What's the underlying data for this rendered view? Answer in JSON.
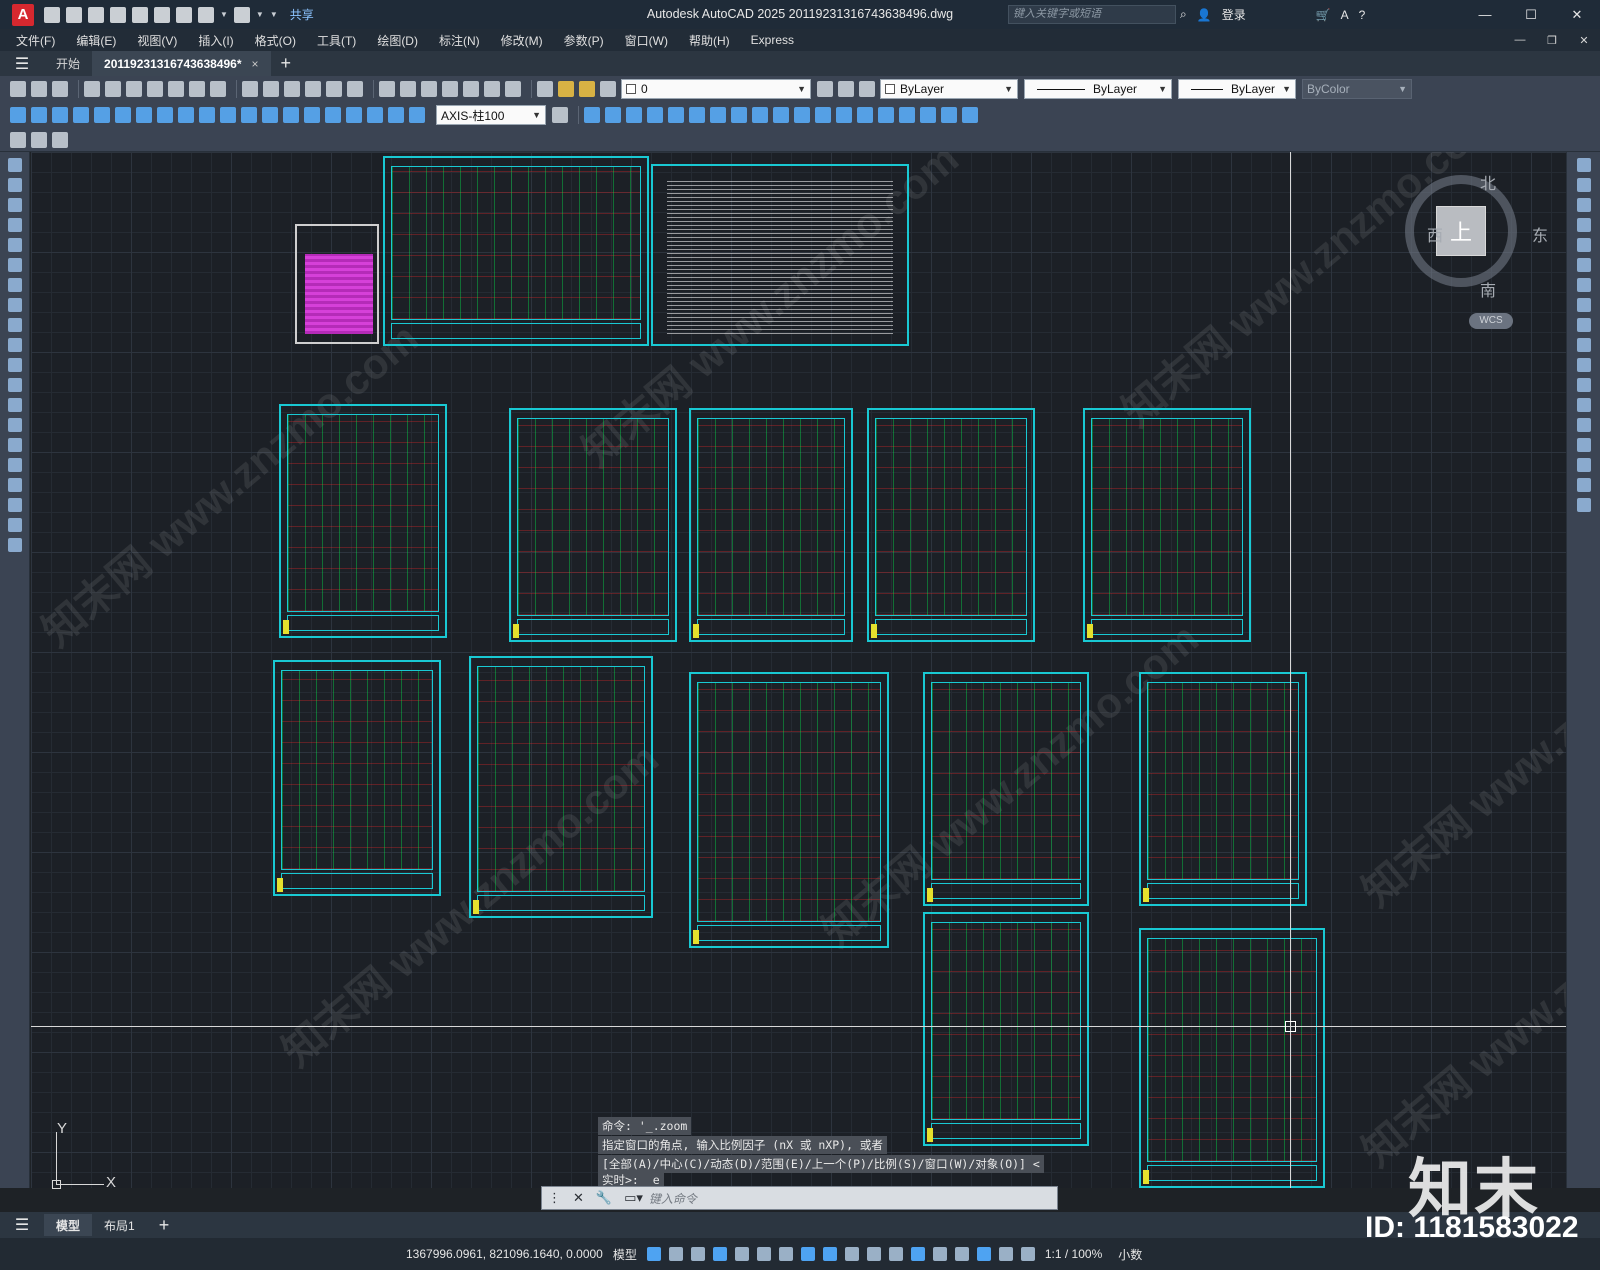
{
  "window": {
    "app_letter": "A",
    "title": "Autodesk AutoCAD 2025    20119231316743638496.dwg",
    "share_label": "共享",
    "search_placeholder": "键入关键字或短语",
    "login_label": "登录",
    "help_label": "?"
  },
  "menu": [
    "文件(F)",
    "编辑(E)",
    "视图(V)",
    "插入(I)",
    "格式(O)",
    "工具(T)",
    "绘图(D)",
    "标注(N)",
    "修改(M)",
    "参数(P)",
    "窗口(W)",
    "帮助(H)",
    "Express"
  ],
  "tabs": {
    "start_label": "开始",
    "active_doc": "20119231316743638496*",
    "close": "×",
    "add": "+"
  },
  "toolbar": {
    "layer_value": "0",
    "color_value": "ByLayer",
    "linetype_value": "ByLayer",
    "lineweight_value": "ByLayer",
    "plotstyle_value": "ByColor",
    "dimstyle_value": "AXIS-柱100"
  },
  "viewcube": {
    "north": "北",
    "south": "南",
    "east": "东",
    "west": "西",
    "top": "上",
    "wcs": "WCS"
  },
  "ucs": {
    "y": "Y",
    "x": "X"
  },
  "command": {
    "line1": "命令: '_.zoom",
    "line2": "指定窗口的角点, 输入比例因子 (nX 或 nXP), 或者",
    "line3": "[全部(A)/中心(C)/动态(D)/范围(E)/上一个(P)/比例(S)/窗口(W)/对象(O)] <",
    "line4": "实时>: _e",
    "input_placeholder": "键入命令"
  },
  "layout_tabs": [
    "模型",
    "布局1"
  ],
  "layout_add": "+",
  "status": {
    "coords": "1367996.0961, 821096.1640, 0.0000",
    "space": "模型",
    "scale": "1:1 / 100%",
    "units": "小数"
  },
  "watermark": {
    "brand": "知末",
    "id": "ID: 1181583022",
    "diag_text": "知末网 www.znzmo.com"
  }
}
